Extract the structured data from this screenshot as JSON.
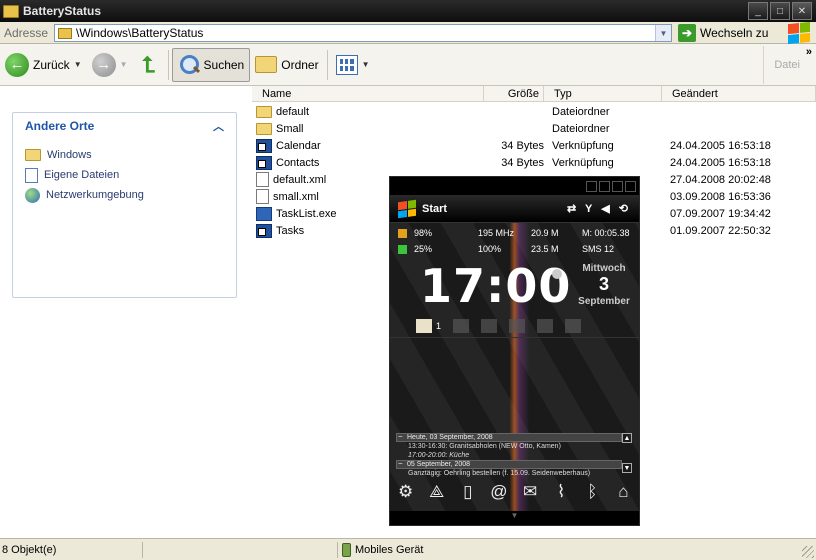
{
  "window": {
    "title": "BatteryStatus"
  },
  "address": {
    "label": "Adresse",
    "path": "\\Windows\\BatteryStatus",
    "go_label": "Wechseln zu"
  },
  "toolbar": {
    "back_label": "Zurück",
    "search_label": "Suchen",
    "folders_label": "Ordner",
    "right_label": "Datei",
    "more_label": "»"
  },
  "taskpane": {
    "title": "Andere Orte",
    "items": [
      {
        "label": "Windows",
        "icon": "folder-icon"
      },
      {
        "label": "Eigene Dateien",
        "icon": "documents-icon"
      },
      {
        "label": "Netzwerkumgebung",
        "icon": "network-icon"
      }
    ]
  },
  "columns": {
    "name": "Name",
    "size": "Größe",
    "type": "Typ",
    "modified": "Geändert"
  },
  "files": [
    {
      "name": "default",
      "size": "",
      "type": "Dateiordner",
      "modified": "",
      "icon": "folder"
    },
    {
      "name": "Small",
      "size": "",
      "type": "Dateiordner",
      "modified": "",
      "icon": "folder"
    },
    {
      "name": "Calendar",
      "size": "34 Bytes",
      "type": "Verknüpfung",
      "modified": "24.04.2005  16:53:18",
      "icon": "link"
    },
    {
      "name": "Contacts",
      "size": "34 Bytes",
      "type": "Verknüpfung",
      "modified": "24.04.2005  16:53:18",
      "icon": "link"
    },
    {
      "name": "default.xml",
      "size": "",
      "type": "",
      "modified": "27.04.2008  20:02:48",
      "icon": "xml"
    },
    {
      "name": "small.xml",
      "size": "",
      "type": "",
      "modified": "03.09.2008  16:53:36",
      "icon": "xml"
    },
    {
      "name": "TaskList.exe",
      "size": "",
      "type": "",
      "modified": "07.09.2007  19:34:42",
      "icon": "exe"
    },
    {
      "name": "Tasks",
      "size": "",
      "type": "",
      "modified": "01.09.2007  22:50:32",
      "icon": "link"
    }
  ],
  "device": {
    "start_label": "Start",
    "stats": {
      "battery": "98%",
      "cpu": "195 MHz",
      "ram": "20.9 M",
      "uptime": "M: 00:05.38",
      "backlight": "25%",
      "signal": "100%",
      "storage": "23.5 M",
      "sms": "SMS 12"
    },
    "time": {
      "hour": "17",
      "minute": "00"
    },
    "date": {
      "weekday": "Mittwoch",
      "day": "3",
      "month": "September"
    },
    "notification_count": "1",
    "calendar": [
      {
        "kind": "header",
        "text": "Heute, 03 September, 2008"
      },
      {
        "kind": "item",
        "text": "13:30-16:30: Granitsabholen (NEW Otto, Kamen)"
      },
      {
        "kind": "item",
        "text": "17:00-20:00: Küche"
      },
      {
        "kind": "header",
        "text": "05 September, 2008"
      },
      {
        "kind": "item",
        "text": "Ganztägig: Oehrling bestellen (f. 15.09. Seidenweberhaus)"
      }
    ]
  },
  "status": {
    "objects": "8 Objekt(e)",
    "location": "Mobiles Gerät"
  }
}
